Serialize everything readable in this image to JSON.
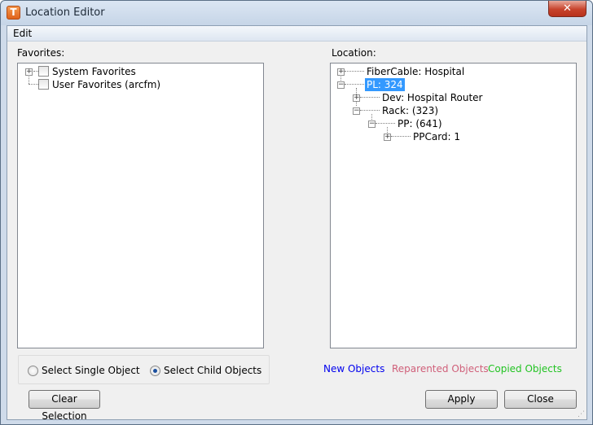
{
  "window": {
    "icon_letter": "T",
    "title": "Location Editor",
    "close_glyph": "✕"
  },
  "menu": {
    "edit": "Edit"
  },
  "favorites": {
    "label": "Favorites:",
    "items": [
      {
        "label": "System Favorites",
        "expandable": true,
        "checked": false
      },
      {
        "label": "User Favorites (arcfm)",
        "expandable": false,
        "checked": false
      }
    ]
  },
  "location": {
    "label": "Location:",
    "nodes": [
      {
        "label": "FiberCable: Hospital",
        "depth": 0,
        "expander": "+",
        "selected": false
      },
      {
        "label": "PL: 324",
        "depth": 0,
        "expander": "−",
        "selected": true
      },
      {
        "label": "Dev: Hospital Router",
        "depth": 1,
        "expander": "+",
        "selected": false
      },
      {
        "label": "Rack: (323)",
        "depth": 1,
        "expander": "−",
        "selected": false
      },
      {
        "label": "PP: (641)",
        "depth": 2,
        "expander": "−",
        "selected": false
      },
      {
        "label": "PPCard: 1",
        "depth": 3,
        "expander": "+",
        "selected": false
      }
    ]
  },
  "selection_mode": {
    "single_label": "Select Single Object",
    "child_label": "Select Child Objects",
    "selected": "child"
  },
  "legend": {
    "new": {
      "label": "New Objects",
      "color": "#0000ee"
    },
    "reparented": {
      "label": "Reparented Objects",
      "color": "#d0607a"
    },
    "copied": {
      "label": "Copied Objects",
      "color": "#22c322"
    }
  },
  "buttons": {
    "clear_selection": "Clear Selection",
    "apply": "Apply",
    "close": "Close"
  }
}
